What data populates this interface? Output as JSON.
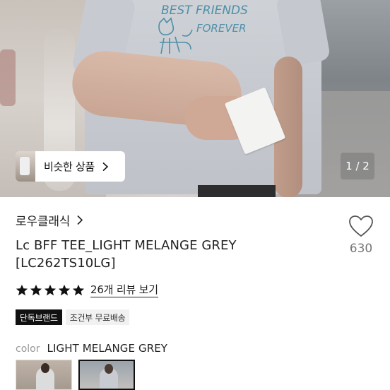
{
  "hero": {
    "similar_products_label": "비슷한 상품",
    "page_indicator": "1 / 2",
    "print_line1": "BEST FRIENDS",
    "print_line2": "FOREVER"
  },
  "product": {
    "brand": "로우클래식",
    "title_line1": "Lc BFF TEE_LIGHT MELANGE GREY",
    "title_line2": "[LC262TS10LG]",
    "like_count": "630",
    "rating_stars": 5,
    "review_link": "26개 리뷰 보기",
    "tags": [
      "단독브랜드",
      "조건부 무료배송"
    ],
    "color_label": "color",
    "color_value": "LIGHT MELANGE GREY",
    "swatch_count": 2,
    "selected_swatch": 2
  },
  "colors": {
    "text_primary": "#222222",
    "text_muted": "#777777",
    "tag_dark_bg": "#111111",
    "tag_light_bg": "#f1f1f1",
    "star": "#111111"
  },
  "icons": {
    "chip_chevron": "chevron-right-icon",
    "brand_chevron": "chevron-right-icon",
    "like": "heart-outline-icon",
    "rating": "star-icon"
  }
}
